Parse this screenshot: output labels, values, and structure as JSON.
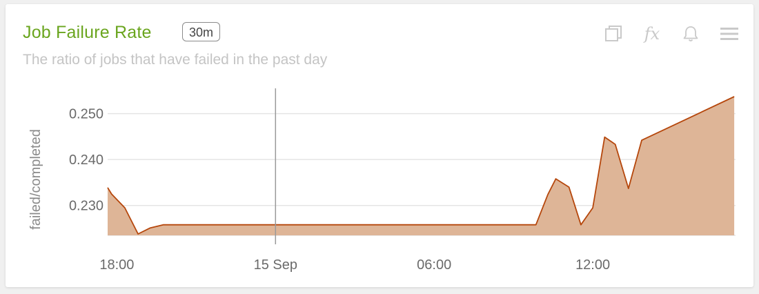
{
  "panel": {
    "title": "Job Failure Rate",
    "interval_badge": "30m",
    "subtitle": "The ratio of jobs that have failed in the past day",
    "toolbar": {
      "icons": [
        "copy-icon",
        "fx-icon",
        "bell-icon",
        "menu-icon"
      ],
      "fx_label": "fx"
    }
  },
  "colors": {
    "title": "#6aa51e",
    "series_fill": "#deb597",
    "series_line": "#b5460b",
    "grid": "#e4e4e4",
    "marker": "#999999"
  },
  "chart_data": {
    "type": "area",
    "ylabel": "failed/completed",
    "xlabel": "",
    "x_ticks": [
      "18:00",
      "15 Sep",
      "06:00",
      "12:00"
    ],
    "y_ticks": [
      0.23,
      0.24,
      0.25
    ],
    "y_tick_labels": [
      "0.230",
      "0.240",
      "0.250"
    ],
    "ylim": [
      0.2235,
      0.2555
    ],
    "xlim_hours": [
      -6.35,
      17.4
    ],
    "marker_label": "15 Sep",
    "grid": true,
    "legend": "none",
    "series": [
      {
        "x_hours": [
          -6.35,
          -6.2,
          -5.7,
          -5.2,
          -4.75,
          -4.25,
          9.85,
          10.3,
          10.6,
          11.1,
          11.55,
          12.0,
          12.45,
          12.85,
          13.35,
          13.85,
          17.35
        ],
        "values": [
          0.2339,
          0.2325,
          0.2295,
          0.2238,
          0.2251,
          0.2258,
          0.2258,
          0.2324,
          0.2358,
          0.234,
          0.2258,
          0.2295,
          0.2449,
          0.2433,
          0.2337,
          0.2442,
          0.2537
        ]
      }
    ]
  }
}
